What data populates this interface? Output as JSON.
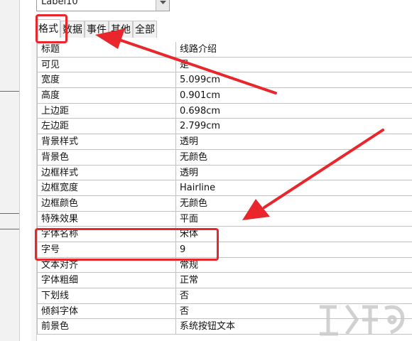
{
  "combo": {
    "value": "Label10"
  },
  "tabs": [
    {
      "label": "格式",
      "active": true
    },
    {
      "label": "数据",
      "active": false
    },
    {
      "label": "事件",
      "active": false
    },
    {
      "label": "其他",
      "active": false
    },
    {
      "label": "全部",
      "active": false
    }
  ],
  "properties": [
    {
      "name": "标题",
      "value": "线路介绍"
    },
    {
      "name": "可见",
      "value": "是"
    },
    {
      "name": "宽度",
      "value": "5.099cm"
    },
    {
      "name": "高度",
      "value": "0.901cm"
    },
    {
      "name": "上边距",
      "value": "0.698cm"
    },
    {
      "name": "左边距",
      "value": "2.799cm"
    },
    {
      "name": "背景样式",
      "value": "透明"
    },
    {
      "name": "背景色",
      "value": "无颜色"
    },
    {
      "name": "边框样式",
      "value": "透明"
    },
    {
      "name": "边框宽度",
      "value": "Hairline"
    },
    {
      "name": "边框颜色",
      "value": "无颜色"
    },
    {
      "name": "特殊效果",
      "value": "平面"
    },
    {
      "name": "字体名称",
      "value": "宋体"
    },
    {
      "name": "字号",
      "value": "9"
    },
    {
      "name": "文本对齐",
      "value": "常规"
    },
    {
      "name": "字体粗细",
      "value": "正常"
    },
    {
      "name": "下划线",
      "value": "否"
    },
    {
      "name": "倾斜字体",
      "value": "否"
    },
    {
      "name": "前景色",
      "value": "系统按钮文本"
    }
  ],
  "colors": {
    "annotation": "#e8262b",
    "grid_line": "#c2c2c2"
  },
  "icons": {
    "combo_dropdown": "chevron-down-icon",
    "watermark": "download-site-logo"
  }
}
